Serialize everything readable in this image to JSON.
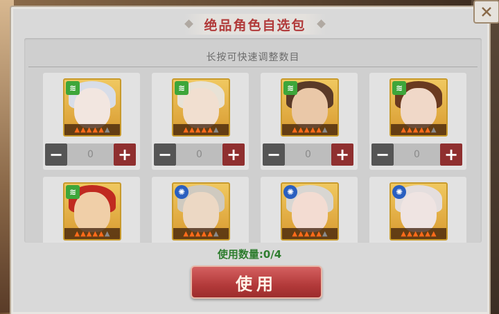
{
  "title": "绝品角色自选包",
  "hint": "长按可快速调整数目",
  "usage": "使用数量:0/4",
  "use_button": "使用",
  "cards": [
    {
      "faction": "green",
      "faction_glyph": "≋",
      "stars": 5,
      "stars_lit": 4,
      "value": "0",
      "hair": "#d8dde8",
      "skin": "#f2e6e0"
    },
    {
      "faction": "green",
      "faction_glyph": "≋",
      "stars": 5,
      "stars_lit": 4,
      "value": "0",
      "hair": "#e8e2d6",
      "skin": "#f1dfd0"
    },
    {
      "faction": "green",
      "faction_glyph": "≋",
      "stars": 5,
      "stars_lit": 4,
      "value": "0",
      "hair": "#5a3a28",
      "skin": "#eac8a8"
    },
    {
      "faction": "green",
      "faction_glyph": "≋",
      "stars": 5,
      "stars_lit": 4,
      "value": "0",
      "hair": "#6a3a20",
      "skin": "#f0d8c8"
    },
    {
      "faction": "green",
      "faction_glyph": "≋",
      "stars": 5,
      "stars_lit": 4,
      "value": null,
      "hair": "#c02a20",
      "skin": "#f0cfa8"
    },
    {
      "faction": "blue",
      "faction_glyph": "✺",
      "stars": 5,
      "stars_lit": 4,
      "value": null,
      "hair": "#cfcac0",
      "skin": "#ecd8c4"
    },
    {
      "faction": "blue",
      "faction_glyph": "✺",
      "stars": 5,
      "stars_lit": 4,
      "value": null,
      "hair": "#d8d6d2",
      "skin": "#f3dcd2"
    },
    {
      "faction": "blue",
      "faction_glyph": "✺",
      "stars": 5,
      "stars_lit": 5,
      "value": null,
      "hair": "#e4dede",
      "skin": "#efe4e2"
    }
  ],
  "icons": {
    "close": "close-icon",
    "minus": "minus-icon",
    "plus": "plus-icon",
    "flame": "flame-icon"
  }
}
